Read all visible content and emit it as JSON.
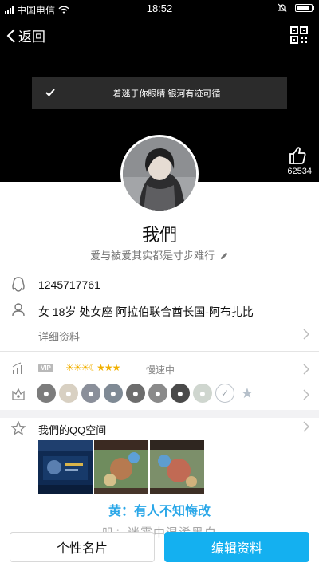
{
  "status_bar": {
    "carrier": "中国电信",
    "time": "18:52",
    "battery_level": 0.9
  },
  "nav": {
    "back_label": "返回",
    "qr_icon": "qr-code-icon"
  },
  "toast": {
    "text": "着迷于你眼睛 银河有迹可循"
  },
  "likes": {
    "count": "62534"
  },
  "profile": {
    "nickname": "我們",
    "signature": "爱与被爱其实都是寸步难行"
  },
  "info": {
    "qq_number": "1245717761",
    "personal": "女  18岁  处女座  阿拉伯联合酋长国-阿布扎比",
    "details_label": "详细资料"
  },
  "level": {
    "vip_tag": "VIP",
    "speed_label": "慢速中"
  },
  "qzone": {
    "title": "我們的QQ空间"
  },
  "overlay": {
    "line1": "黄：有人不知悔改",
    "line2": "叽：迷雾中混淆黑白"
  },
  "buttons": {
    "card_label": "个性名片",
    "edit_label": "编辑资料"
  },
  "colors": {
    "accent": "#14b0f0",
    "header_bg": "#000000",
    "overlay_text": "#2aa7e8"
  }
}
